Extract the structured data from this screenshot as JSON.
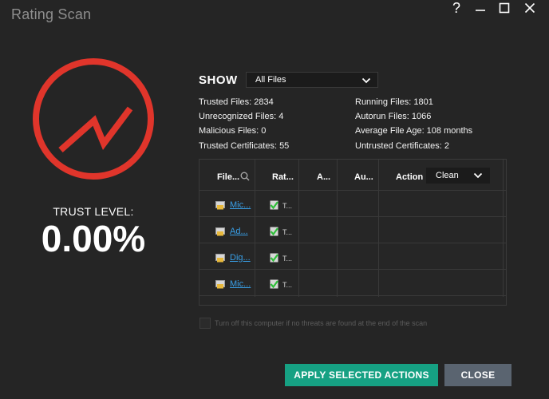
{
  "window": {
    "title": "Rating Scan",
    "controls": {
      "help": "?",
      "minimize": "—",
      "maximize": "☐",
      "close": "✕"
    }
  },
  "trust": {
    "label": "TRUST LEVEL:",
    "value": "0.00%",
    "gauge_icon": "trend-up-icon",
    "color": "#e0352b"
  },
  "show": {
    "label": "SHOW",
    "selected": "All Files"
  },
  "stats": {
    "trusted_files": "Trusted Files: 2834",
    "unrecognized_files": "Unrecognized Files: 4",
    "malicious_files": "Malicious Files: 0",
    "trusted_certificates": "Trusted Certificates: 55",
    "running_files": "Running Files: 1801",
    "autorun_files": "Autorun Files: 1066",
    "average_file_age": "Average File Age: 108 months",
    "untrusted_certificates": "Untrusted Certificates: 2"
  },
  "table": {
    "columns": [
      "File...",
      "Rat...",
      "A...",
      "Au...",
      "Action"
    ],
    "action_selected": "Clean",
    "rows": [
      {
        "file": "Mic...",
        "rating": "T..."
      },
      {
        "file": "Ad...",
        "rating": "T..."
      },
      {
        "file": "Dig...",
        "rating": "T..."
      },
      {
        "file": "Mic...",
        "rating": "T..."
      }
    ]
  },
  "shutdown_option": {
    "label": "Turn off this computer if no threats are found at the end of the scan",
    "checked": false
  },
  "buttons": {
    "apply": "APPLY SELECTED ACTIONS",
    "close": "CLOSE"
  },
  "colors": {
    "accent": "#16a183",
    "danger": "#e0352b",
    "link": "#39a0e8",
    "secondary_button": "#5a6470"
  }
}
